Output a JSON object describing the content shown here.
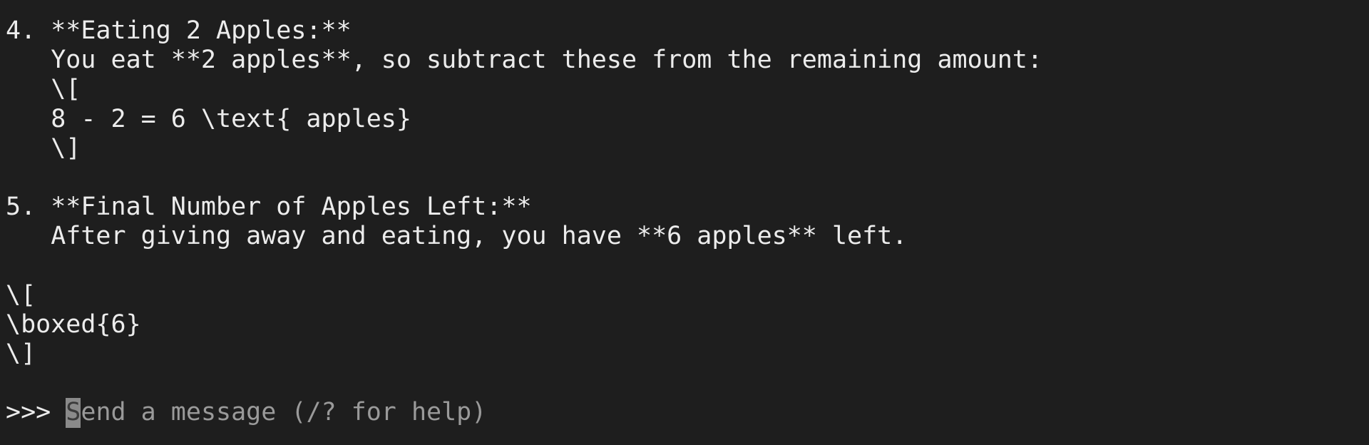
{
  "output": {
    "lines": [
      "4. **Eating 2 Apples:**",
      "   You eat **2 apples**, so subtract these from the remaining amount:",
      "   \\[",
      "   8 - 2 = 6 \\text{ apples}",
      "   \\]",
      "",
      "5. **Final Number of Apples Left:**",
      "   After giving away and eating, you have **6 apples** left.",
      "",
      "\\[",
      "\\boxed{6}",
      "\\]",
      ""
    ]
  },
  "input": {
    "prompt": ">>> ",
    "cursor_char": "S",
    "placeholder_rest": "end a message (/? for help)"
  }
}
